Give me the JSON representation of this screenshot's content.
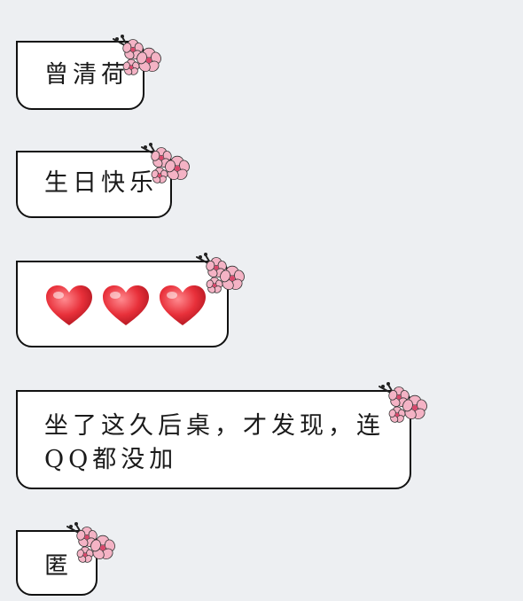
{
  "chat": {
    "messages": [
      {
        "text": "曾清荷"
      },
      {
        "text": "生日快乐"
      },
      {
        "emoji": [
          "heart-icon",
          "heart-icon",
          "heart-icon"
        ]
      },
      {
        "text": "坐了这久后桌，才发现，连\nQQ都没加"
      },
      {
        "text": "匿"
      }
    ]
  },
  "theme": {
    "background": "#edeff2",
    "heart": "#e8303a",
    "flower": "#f4b3c5"
  }
}
